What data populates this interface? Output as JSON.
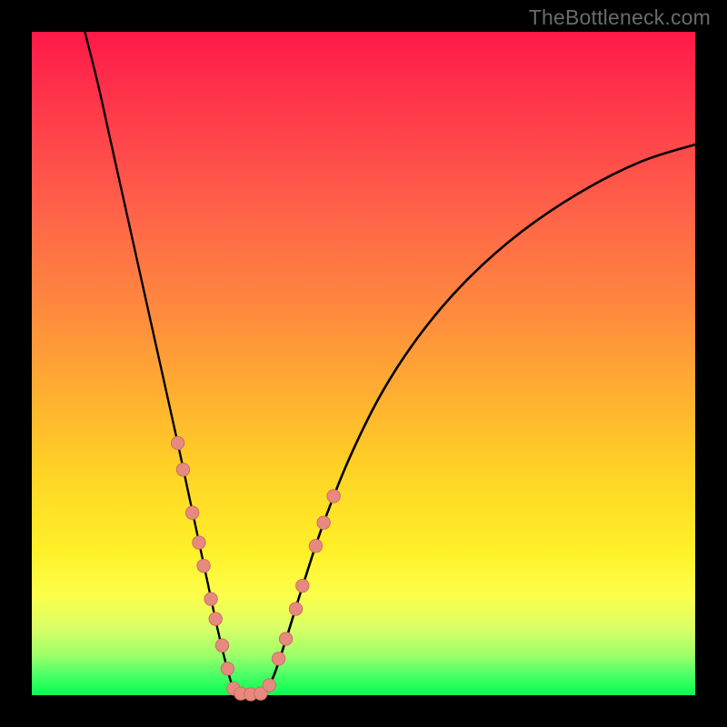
{
  "watermark": "TheBottleneck.com",
  "colors": {
    "bg": "#000000",
    "curve": "#000000",
    "marker_fill": "#e68a80",
    "marker_stroke": "#cf6e63",
    "gradient_top": "#ff1848",
    "gradient_bottom": "#19ee56"
  },
  "chart_data": {
    "type": "line",
    "title": "",
    "xlabel": "",
    "ylabel": "",
    "xlim": [
      0,
      100
    ],
    "ylim": [
      0,
      100
    ],
    "grid": false,
    "legend": false,
    "annotations": [],
    "series": [
      {
        "name": "left-branch",
        "x": [
          8,
          10,
          12,
          14,
          16,
          18,
          20,
          22,
          23.5,
          25,
          26.5,
          28,
          29.2,
          30.2,
          31
        ],
        "y": [
          100,
          92,
          83,
          74,
          65,
          56,
          47,
          38,
          31,
          24,
          17,
          10,
          5,
          1.5,
          0.3
        ]
      },
      {
        "name": "valley-floor",
        "x": [
          31,
          32,
          33,
          34,
          35
        ],
        "y": [
          0.3,
          0.1,
          0.1,
          0.1,
          0.3
        ]
      },
      {
        "name": "right-branch",
        "x": [
          35,
          36.5,
          38.5,
          41,
          44,
          48,
          53,
          59,
          66,
          74,
          83,
          92,
          100
        ],
        "y": [
          0.3,
          3,
          9,
          17,
          26,
          36,
          46,
          55,
          63,
          70,
          76,
          80.5,
          83
        ]
      }
    ],
    "markers": [
      {
        "branch": "left",
        "x": 22.0,
        "y": 38.0
      },
      {
        "branch": "left",
        "x": 22.8,
        "y": 34.0
      },
      {
        "branch": "left",
        "x": 24.2,
        "y": 27.5
      },
      {
        "branch": "left",
        "x": 25.2,
        "y": 23.0
      },
      {
        "branch": "left",
        "x": 25.9,
        "y": 19.5
      },
      {
        "branch": "left",
        "x": 27.0,
        "y": 14.5
      },
      {
        "branch": "left",
        "x": 27.7,
        "y": 11.5
      },
      {
        "branch": "left",
        "x": 28.7,
        "y": 7.5
      },
      {
        "branch": "left",
        "x": 29.5,
        "y": 4.0
      },
      {
        "branch": "left",
        "x": 30.4,
        "y": 1.0
      },
      {
        "branch": "floor",
        "x": 31.5,
        "y": 0.25
      },
      {
        "branch": "floor",
        "x": 33.0,
        "y": 0.15
      },
      {
        "branch": "floor",
        "x": 34.5,
        "y": 0.25
      },
      {
        "branch": "right",
        "x": 35.8,
        "y": 1.5
      },
      {
        "branch": "right",
        "x": 37.2,
        "y": 5.5
      },
      {
        "branch": "right",
        "x": 38.3,
        "y": 8.5
      },
      {
        "branch": "right",
        "x": 39.8,
        "y": 13.0
      },
      {
        "branch": "right",
        "x": 40.8,
        "y": 16.5
      },
      {
        "branch": "right",
        "x": 42.8,
        "y": 22.5
      },
      {
        "branch": "right",
        "x": 44.0,
        "y": 26.0
      },
      {
        "branch": "right",
        "x": 45.5,
        "y": 30.0
      }
    ]
  }
}
